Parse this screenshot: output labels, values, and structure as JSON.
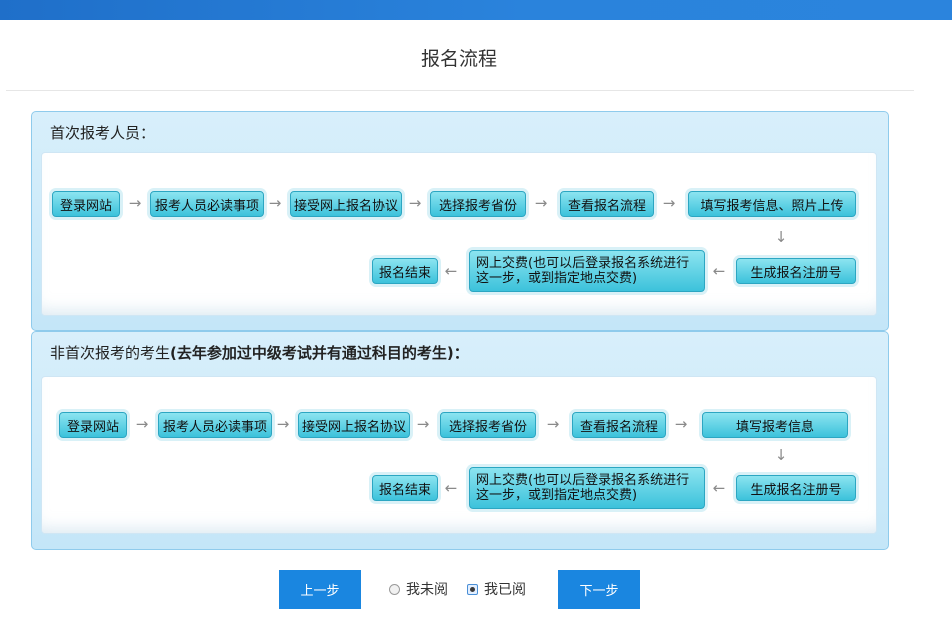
{
  "page": {
    "title": "报名流程"
  },
  "panel1": {
    "heading": "首次报考人员：",
    "row1": [
      "登录网站",
      "报考人员必读事项",
      "接受网上报名协议",
      "选择报考省份",
      "查看报名流程",
      "填写报考信息、照片上传"
    ],
    "row2": [
      "生成报名注册号",
      "网上交费(也可以后登录报名系统进行这一步，或到指定地点交费)",
      "报名结束"
    ]
  },
  "panel2": {
    "heading_plain": "非首次报考的考生",
    "heading_bold": "(去年参加过中级考试并有通过科目的考生)：",
    "row1": [
      "登录网站",
      "报考人员必读事项",
      "接受网上报名协议",
      "选择报考省份",
      "查看报名流程",
      "填写报考信息"
    ],
    "row2": [
      "生成报名注册号",
      "网上交费(也可以后登录报名系统进行这一步，或到指定地点交费)",
      "报名结束"
    ]
  },
  "icons": {
    "right": "→",
    "left": "←",
    "down": "↓"
  },
  "footer": {
    "prev_label": "上一步",
    "unread_label": "我未阅",
    "read_label": "我已阅",
    "next_label": "下一步",
    "selected": "我已阅"
  }
}
